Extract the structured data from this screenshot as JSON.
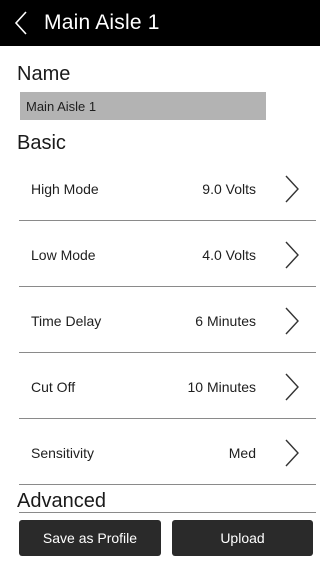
{
  "header": {
    "title": "Main Aisle 1",
    "back_icon": "chevron-left-icon"
  },
  "name_section": {
    "label": "Name",
    "value": "Main Aisle 1"
  },
  "basic_section": {
    "label": "Basic",
    "rows": [
      {
        "label": "High Mode",
        "value": "9.0 Volts"
      },
      {
        "label": "Low Mode",
        "value": "4.0 Volts"
      },
      {
        "label": "Time Delay",
        "value": "6 Minutes"
      },
      {
        "label": "Cut Off",
        "value": "10 Minutes"
      },
      {
        "label": "Sensitivity",
        "value": "Med"
      }
    ]
  },
  "advanced_section": {
    "label": "Advanced"
  },
  "actions": {
    "save_label": "Save as Profile",
    "upload_label": "Upload"
  },
  "colors": {
    "header_bg": "#000000",
    "field_bg": "#b3b3b3",
    "button_bg": "#2a2a2a"
  }
}
